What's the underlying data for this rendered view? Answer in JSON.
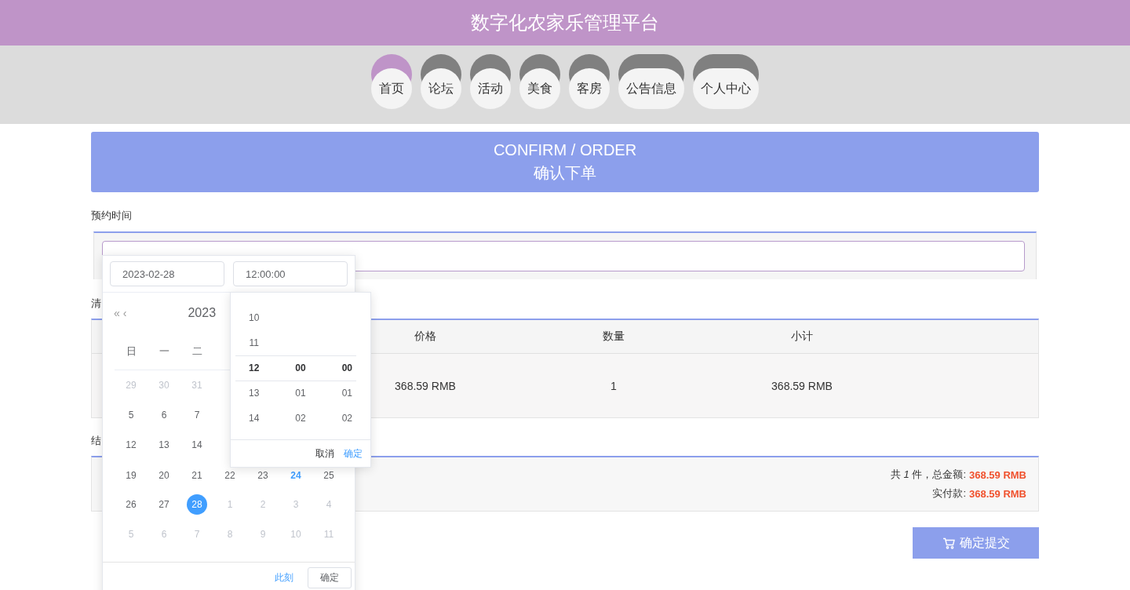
{
  "header": {
    "title": "数字化农家乐管理平台"
  },
  "nav": [
    {
      "label": "首页",
      "selected": true
    },
    {
      "label": "论坛",
      "selected": false
    },
    {
      "label": "活动",
      "selected": false
    },
    {
      "label": "美食",
      "selected": false
    },
    {
      "label": "客房",
      "selected": false
    },
    {
      "label": "公告信息",
      "selected": false
    },
    {
      "label": "个人中心",
      "selected": false
    }
  ],
  "banner": {
    "title": "CONFIRM / ORDER",
    "subtitle": "确认下单"
  },
  "booking": {
    "label": "预约时间"
  },
  "list": {
    "label": "清",
    "columns": [
      "价格",
      "数量",
      "小计"
    ],
    "rows": [
      [
        "368.59 RMB",
        "1",
        "368.59 RMB"
      ]
    ]
  },
  "checkout": {
    "label": "结",
    "count_line": "共 *1* 件，总金额:",
    "total": "368.59 RMB",
    "paid_label": "实付款:",
    "paid": "368.59 RMB"
  },
  "submit": {
    "label": "确定提交"
  },
  "picker": {
    "date_value": "2023-02-28",
    "time_value": "12:00:00",
    "year": "2023",
    "prev_year": "«",
    "prev_month": "‹",
    "weekdays": [
      "日",
      "一",
      "二"
    ],
    "weeks": [
      [
        {
          "day": "29",
          "muted": true,
          "today": false,
          "selected": false
        },
        {
          "day": "30",
          "muted": true,
          "today": false,
          "selected": false
        },
        {
          "day": "31",
          "muted": true,
          "today": false,
          "selected": false
        }
      ],
      [
        {
          "day": "5",
          "muted": false,
          "today": false,
          "selected": false
        },
        {
          "day": "6",
          "muted": false,
          "today": false,
          "selected": false
        },
        {
          "day": "7",
          "muted": false,
          "today": false,
          "selected": false
        }
      ],
      [
        {
          "day": "12",
          "muted": false,
          "today": false,
          "selected": false
        },
        {
          "day": "13",
          "muted": false,
          "today": false,
          "selected": false
        },
        {
          "day": "14",
          "muted": false,
          "today": false,
          "selected": false
        }
      ],
      [
        {
          "day": "19",
          "muted": false,
          "today": false,
          "selected": false
        },
        {
          "day": "20",
          "muted": false,
          "today": false,
          "selected": false
        },
        {
          "day": "21",
          "muted": false,
          "today": false,
          "selected": false
        },
        {
          "day": "22",
          "muted": false,
          "today": false,
          "selected": false
        },
        {
          "day": "23",
          "muted": false,
          "today": false,
          "selected": false
        },
        {
          "day": "24",
          "muted": false,
          "today": true,
          "selected": false
        },
        {
          "day": "25",
          "muted": false,
          "today": false,
          "selected": false
        }
      ],
      [
        {
          "day": "26",
          "muted": false,
          "today": false,
          "selected": false
        },
        {
          "day": "27",
          "muted": false,
          "today": false,
          "selected": false
        },
        {
          "day": "28",
          "muted": false,
          "today": false,
          "selected": true
        },
        {
          "day": "1",
          "muted": true,
          "today": false,
          "selected": false
        },
        {
          "day": "2",
          "muted": true,
          "today": false,
          "selected": false
        },
        {
          "day": "3",
          "muted": true,
          "today": false,
          "selected": false
        },
        {
          "day": "4",
          "muted": true,
          "today": false,
          "selected": false
        }
      ],
      [
        {
          "day": "5",
          "muted": true,
          "today": false,
          "selected": false
        },
        {
          "day": "6",
          "muted": true,
          "today": false,
          "selected": false
        },
        {
          "day": "7",
          "muted": true,
          "today": false,
          "selected": false
        },
        {
          "day": "8",
          "muted": true,
          "today": false,
          "selected": false
        },
        {
          "day": "9",
          "muted": true,
          "today": false,
          "selected": false
        },
        {
          "day": "10",
          "muted": true,
          "today": false,
          "selected": false
        },
        {
          "day": "11",
          "muted": true,
          "today": false,
          "selected": false
        }
      ]
    ],
    "now_link": "此刻",
    "ok_button": "确定",
    "time_panel": {
      "columns": [
        [
          {
            "text": "10",
            "selected": false
          },
          {
            "text": "11",
            "selected": false
          },
          {
            "text": "12",
            "selected": true
          },
          {
            "text": "13",
            "selected": false
          },
          {
            "text": "14",
            "selected": false
          }
        ],
        [
          {
            "text": "00",
            "selected": true
          },
          {
            "text": "01",
            "selected": false
          },
          {
            "text": "02",
            "selected": false
          }
        ],
        [
          {
            "text": "00",
            "selected": true
          },
          {
            "text": "01",
            "selected": false
          },
          {
            "text": "02",
            "selected": false
          }
        ]
      ],
      "cancel": "取消",
      "ok": "确定"
    }
  }
}
